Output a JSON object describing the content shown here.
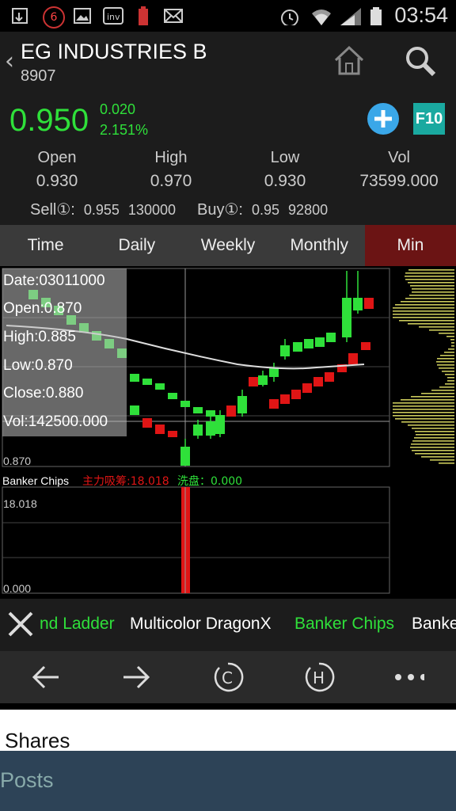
{
  "status_bar": {
    "time": "03:54",
    "notif_count": "6",
    "icons": [
      "download-icon",
      "notification-badge-icon",
      "image-icon",
      "investing-app-icon",
      "battery-warning-icon",
      "email-icon",
      "alarm-icon",
      "wifi-icon",
      "signal-icon",
      "battery-icon"
    ]
  },
  "header": {
    "back_icon": "‹",
    "title": "EG INDUSTRIES B",
    "code": "8907",
    "icons": [
      "home-icon",
      "search-icon"
    ]
  },
  "quote": {
    "price": "0.950",
    "change": "0.020",
    "change_pct": "2.151%",
    "add_icon": "plus-icon",
    "f10_label": "F10",
    "stats": [
      {
        "label": "Open",
        "value": "0.930"
      },
      {
        "label": "High",
        "value": "0.970"
      },
      {
        "label": "Low",
        "value": "0.930"
      },
      {
        "label": "Vol",
        "value": "73599.000"
      }
    ],
    "sell_label": "Sell①:",
    "sell_price": "0.955",
    "sell_qty": "130000",
    "buy_label": "Buy①:",
    "buy_price": "0.95",
    "buy_qty": "92800",
    "colors": {
      "up": "#2fe03a",
      "down": "#e01515"
    }
  },
  "tabs": [
    {
      "label": "Time",
      "active": false
    },
    {
      "label": "Daily",
      "active": false
    },
    {
      "label": "Weekly",
      "active": false
    },
    {
      "label": "Monthly",
      "active": false
    },
    {
      "label": "Min",
      "active": true
    }
  ],
  "chart_data": {
    "type": "candlestick",
    "price_axis": {
      "bottom_label": "0.870"
    },
    "tooltip": {
      "date": "Date:03011000",
      "open": "Open:0.870",
      "high": "High:0.885",
      "low": "Low:0.870",
      "close": "Close:0.880",
      "vol": "Vol:142500.000"
    },
    "indicator": {
      "name": "Banker Chips",
      "label1": "主力吸筹:18.018",
      "label2": "洗盘：0.000",
      "ymax_label": "18.018",
      "ymin_label": "0.000"
    }
  },
  "indicator_strip": {
    "close_icon": "close-icon",
    "items": [
      {
        "label": "nd Ladder",
        "color": "#2fe03a"
      },
      {
        "label": "Multicolor DragonX",
        "color": "#ffffff"
      },
      {
        "label": "Banker Chips",
        "color": "#2fe03a"
      },
      {
        "label": "Banke",
        "color": "#ffffff"
      }
    ]
  },
  "nav": {
    "icons": [
      "arrow-left-icon",
      "arrow-right-icon",
      "c-circle-icon",
      "h-circle-icon",
      "more-icon"
    ],
    "c_label": "C",
    "h_label": "H"
  },
  "bottom": {
    "shares_label": "Shares",
    "posts_label": "Posts"
  }
}
